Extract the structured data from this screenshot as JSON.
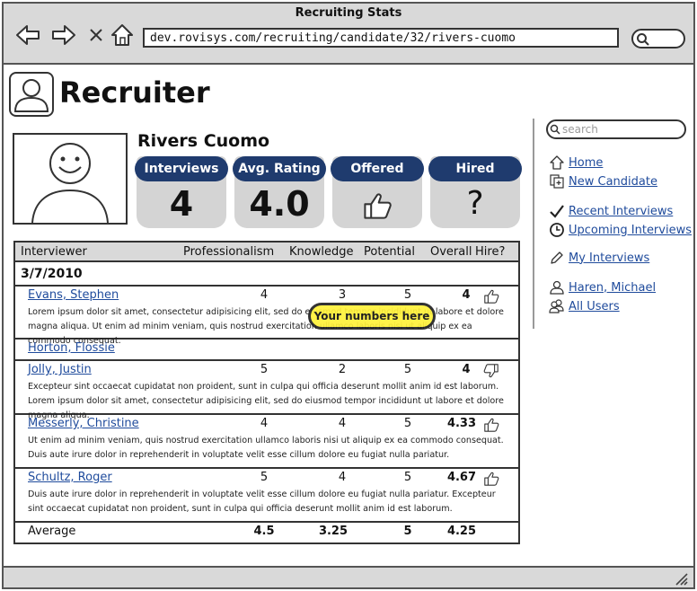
{
  "window": {
    "title": "Recruiting Stats",
    "url": "dev.rovisys.com/recruiting/candidate/32/rivers-cuomo"
  },
  "app": {
    "title": "Recruiter"
  },
  "candidate": {
    "name": "Rivers Cuomo"
  },
  "stats": [
    {
      "label": "Interviews",
      "value": "4"
    },
    {
      "label": "Avg. Rating",
      "value": "4.0"
    },
    {
      "label": "Offered",
      "icon": "thumbs-up-icon"
    },
    {
      "label": "Hired",
      "value": "?"
    }
  ],
  "table": {
    "headers": {
      "interviewer": "Interviewer",
      "professionalism": "Professionalism",
      "knowledge": "Knowledge",
      "potential": "Potential",
      "overall": "Overall",
      "hire": "Hire?"
    },
    "date": "3/7/2010",
    "rows": [
      {
        "name": "Evans, Stephen",
        "professionalism": "4",
        "knowledge": "3",
        "potential": "5",
        "overall": "4",
        "hire": "thumbs-up-icon",
        "comment": "Lorem ipsum dolor sit amet, consectetur adipisicing elit, sed do eiusmod tempor incididunt ut labore et dolore magna aliqua. Ut enim ad minim veniam, quis nostrud exercitation ullamco laboris nisi ut aliquip ex ea commodo consequat."
      },
      {
        "name": "Horton, Flossie"
      },
      {
        "name": "Jolly, Justin",
        "professionalism": "5",
        "knowledge": "2",
        "potential": "5",
        "overall": "4",
        "hire": "thumbs-down-icon",
        "comment": "Excepteur sint occaecat cupidatat non proident, sunt in culpa qui officia deserunt mollit anim id est laborum. Lorem ipsum dolor sit amet, consectetur adipisicing elit, sed do eiusmod tempor incididunt ut labore et dolore magna aliqua."
      },
      {
        "name": "Messerly, Christine",
        "professionalism": "4",
        "knowledge": "4",
        "potential": "5",
        "overall": "4.33",
        "hire": "thumbs-up-icon",
        "comment": "Ut enim ad minim veniam, quis nostrud exercitation ullamco laboris nisi ut aliquip ex ea commodo consequat. Duis aute irure dolor in reprehenderit in voluptate velit esse cillum dolore eu fugiat nulla pariatur."
      },
      {
        "name": "Schultz, Roger",
        "professionalism": "5",
        "knowledge": "4",
        "potential": "5",
        "overall": "4.67",
        "hire": "thumbs-up-icon",
        "comment": "Duis aute irure dolor in reprehenderit in voluptate velit esse cillum dolore eu fugiat nulla pariatur. Excepteur sint occaecat cupidatat non proident, sunt in culpa qui officia deserunt mollit anim id est laborum."
      }
    ],
    "average": {
      "label": "Average",
      "professionalism": "4.5",
      "knowledge": "3.25",
      "potential": "5",
      "overall": "4.25"
    }
  },
  "tooltip": "Your numbers here",
  "sidebar": {
    "search_placeholder": "search",
    "items": [
      {
        "label": "Home",
        "icon": "home-icon"
      },
      {
        "label": "New Candidate",
        "icon": "new-document-icon"
      },
      {
        "label": "Recent Interviews",
        "icon": "checkmark-icon"
      },
      {
        "label": "Upcoming Interviews",
        "icon": "clock-icon"
      },
      {
        "label": "My Interviews",
        "icon": "pencil-icon"
      },
      {
        "label": "Haren, Michael",
        "icon": "user-icon"
      },
      {
        "label": "All Users",
        "icon": "users-icon"
      }
    ]
  }
}
